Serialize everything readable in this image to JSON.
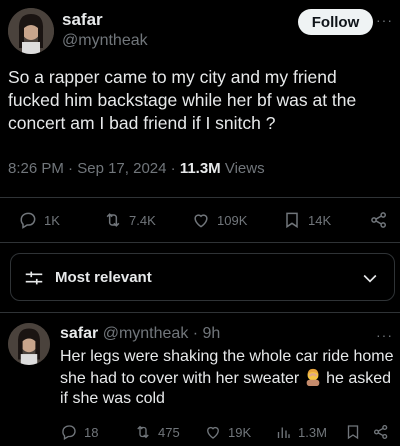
{
  "post": {
    "author": {
      "name": "safar",
      "handle": "@myntheak"
    },
    "follow_label": "Follow",
    "more_label": "···",
    "text": "So a rapper came to my city and my friend fucked him backstage while her bf was at the concert am I bad friend if I snitch ?",
    "time": "8:26 PM",
    "sep1": " · ",
    "date": "Sep 17, 2024",
    "sep2": " · ",
    "views_count": "11.3M",
    "views_label": " Views",
    "actions": {
      "replies": "1K",
      "reposts": "7.4K",
      "likes": "109K",
      "bookmarks": "14K"
    }
  },
  "sort": {
    "label": "Most relevant"
  },
  "reply": {
    "author": {
      "name": "safar",
      "handle": "@myntheak"
    },
    "dot": " · ",
    "time": "9h",
    "more_label": "···",
    "text_before": "Her legs were shaking the whole car ride home she had to cover with her sweater ",
    "text_after": " he asked if she was cold",
    "actions": {
      "replies": "18",
      "reposts": "475",
      "likes": "19K",
      "views": "1.3M"
    }
  },
  "colors": {
    "background": "#000000",
    "text": "#e7e9ea",
    "muted": "#71767b",
    "border": "#2f3336",
    "follow_bg": "#eff3f4"
  },
  "icons": [
    "avatar",
    "more-icon",
    "reply-icon",
    "repost-icon",
    "like-icon",
    "bookmark-icon",
    "share-icon",
    "sort-icon",
    "chevron-down-icon",
    "views-icon",
    "person-facepalming-emoji"
  ]
}
